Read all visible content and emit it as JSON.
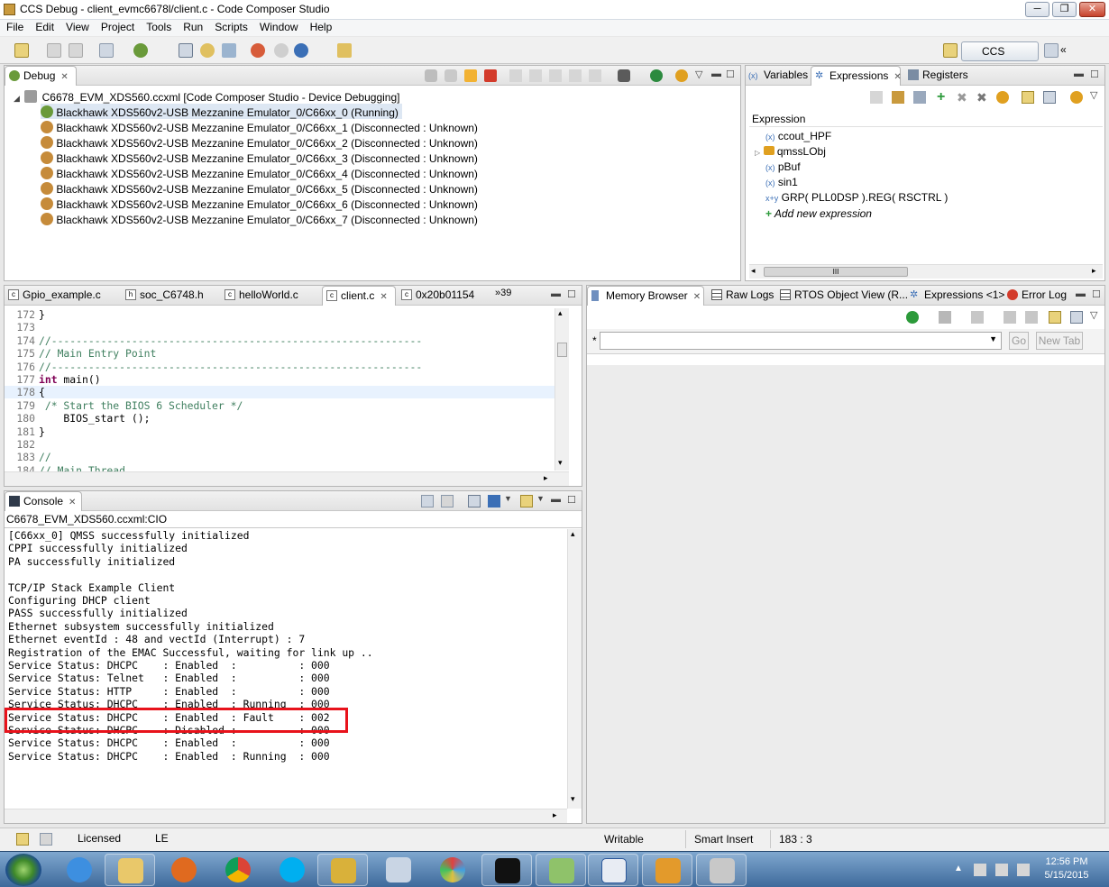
{
  "window": {
    "title": "CCS Debug - client_evmc6678l/client.c - Code Composer Studio",
    "min": "─",
    "max": "❐",
    "close": "✕"
  },
  "menu": [
    "File",
    "Edit",
    "View",
    "Project",
    "Tools",
    "Run",
    "Scripts",
    "Window",
    "Help"
  ],
  "perspective": {
    "label": "CCS Debug",
    "more": "«"
  },
  "debug_view": {
    "tab": "Debug",
    "root": "C6678_EVM_XDS560.ccxml [Code Composer Studio - Device Debugging]",
    "cores": [
      "Blackhawk XDS560v2-USB Mezzanine Emulator_0/C66xx_0 (Running)",
      "Blackhawk XDS560v2-USB Mezzanine Emulator_0/C66xx_1 (Disconnected : Unknown)",
      "Blackhawk XDS560v2-USB Mezzanine Emulator_0/C66xx_2 (Disconnected : Unknown)",
      "Blackhawk XDS560v2-USB Mezzanine Emulator_0/C66xx_3 (Disconnected : Unknown)",
      "Blackhawk XDS560v2-USB Mezzanine Emulator_0/C66xx_4 (Disconnected : Unknown)",
      "Blackhawk XDS560v2-USB Mezzanine Emulator_0/C66xx_5 (Disconnected : Unknown)",
      "Blackhawk XDS560v2-USB Mezzanine Emulator_0/C66xx_6 (Disconnected : Unknown)",
      "Blackhawk XDS560v2-USB Mezzanine Emulator_0/C66xx_7 (Disconnected : Unknown)"
    ]
  },
  "expressions_view": {
    "tabs": [
      "Variables",
      "Expressions",
      "Registers"
    ],
    "header": "Expression",
    "items": [
      "ccout_HPF",
      "qmssLObj",
      "pBuf",
      "sin1",
      "GRP( PLL0DSP ).REG( RSCTRL )"
    ],
    "add_new": "Add new expression",
    "hscroll_grip": "III"
  },
  "editor": {
    "tabs": [
      "Gpio_example.c",
      "soc_C6748.h",
      "helloWorld.c",
      "client.c",
      "0x20b01154"
    ],
    "overflow": "»39",
    "lines": [
      {
        "n": "172",
        "text": "}"
      },
      {
        "n": "173",
        "text": ""
      },
      {
        "n": "174",
        "text": "//------------------------------------------------------------"
      },
      {
        "n": "175",
        "text": "// Main Entry Point"
      },
      {
        "n": "176",
        "text": "//------------------------------------------------------------"
      },
      {
        "n": "177",
        "kw": "int",
        "text": " main()"
      },
      {
        "n": "178",
        "text": "{"
      },
      {
        "n": "179",
        "text": " /* Start the BIOS 6 Scheduler */"
      },
      {
        "n": "180",
        "text": "    BIOS_start ();"
      },
      {
        "n": "181",
        "text": "}"
      },
      {
        "n": "182",
        "text": ""
      },
      {
        "n": "183",
        "text": "//"
      },
      {
        "n": "184",
        "text": "// Main Thread"
      }
    ]
  },
  "memory_view": {
    "tabs": [
      "Memory Browser",
      "Raw Logs",
      "RTOS Object View (R...",
      "Expressions <1>",
      "Error Log"
    ],
    "address_label": "*",
    "go_button": "Go",
    "new_tab_button": "New Tab"
  },
  "console": {
    "tab": "Console",
    "source": "C6678_EVM_XDS560.ccxml:CIO",
    "lines": [
      "[C66xx_0] QMSS successfully initialized",
      "CPPI successfully initialized",
      "PA successfully initialized",
      "",
      "TCP/IP Stack Example Client",
      "Configuring DHCP client",
      "PASS successfully initialized",
      "Ethernet subsystem successfully initialized",
      "Ethernet eventId : 48 and vectId (Interrupt) : 7",
      "Registration of the EMAC Successful, waiting for link up ..",
      "Service Status: DHCPC    : Enabled  :          : 000",
      "Service Status: Telnet   : Enabled  :          : 000",
      "Service Status: HTTP     : Enabled  :          : 000",
      "Service Status: DHCPC    : Enabled  : Running  : 000",
      "Service Status: DHCPC    : Enabled  : Fault    : 002",
      "Service Status: DHCPC    : Disabled :          : 000",
      "Service Status: DHCPC    : Enabled  :          : 000",
      "Service Status: DHCPC    : Enabled  : Running  : 000"
    ],
    "highlight_color": "#e8121b"
  },
  "statusbar": {
    "license": "Licensed",
    "le": "LE",
    "writable": "Writable",
    "insert_mode": "Smart Insert",
    "position": "183 : 3"
  },
  "taskbar": {
    "clock_time": "12:56 PM",
    "clock_date": "5/15/2015",
    "apps": [
      "internet-explorer",
      "file-explorer",
      "firefox",
      "chrome",
      "skype",
      "notes-app",
      "calculator",
      "paint",
      "command-prompt",
      "notepad-plus",
      "word-document",
      "outlook",
      "virtualbox"
    ]
  }
}
